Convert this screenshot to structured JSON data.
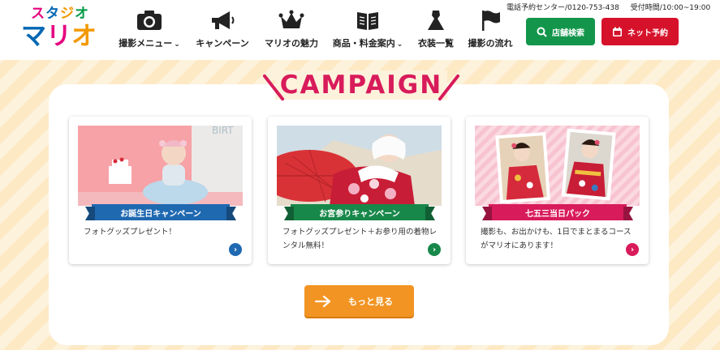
{
  "logo": {
    "line1": "スタジオ",
    "line2": "マリオ"
  },
  "nav": [
    {
      "label": "撮影メニュー",
      "icon": "camera-icon",
      "dropdown": true
    },
    {
      "label": "キャンペーン",
      "icon": "megaphone-icon",
      "dropdown": false
    },
    {
      "label": "マリオの魅力",
      "icon": "crown-icon",
      "dropdown": false
    },
    {
      "label": "商品・料金案内",
      "icon": "book-icon",
      "dropdown": true
    },
    {
      "label": "衣装一覧",
      "icon": "dress-icon",
      "dropdown": false
    },
    {
      "label": "撮影の流れ",
      "icon": "flag-icon",
      "dropdown": false
    }
  ],
  "contact": {
    "phone": "電話予約センター/0120-753-438",
    "hours": "受付時間/10:00~19:00"
  },
  "buttons": {
    "store_search": "店舗検索",
    "online_reserve": "ネット予約",
    "more": "もっと見る"
  },
  "campaign": {
    "title": "CAMPAIGN",
    "cards": [
      {
        "ribbon": "お誕生日キャンペーン",
        "desc": "フォトグッズプレゼント！",
        "color": "#1f69b1"
      },
      {
        "ribbon": "お宮参りキャンペーン",
        "desc": "フォトグッズプレゼント＋お参り用の着物レンタル無料！",
        "color": "#18884a"
      },
      {
        "ribbon": "七五三当日パック",
        "desc": "撮影も、お出かけも、1日でまとまるコースがマリオにあります！",
        "color": "#d81b5b"
      }
    ]
  },
  "colors": {
    "accent_pink": "#d81b5b",
    "green": "#13964b",
    "red": "#d6122b",
    "orange": "#f29423"
  }
}
